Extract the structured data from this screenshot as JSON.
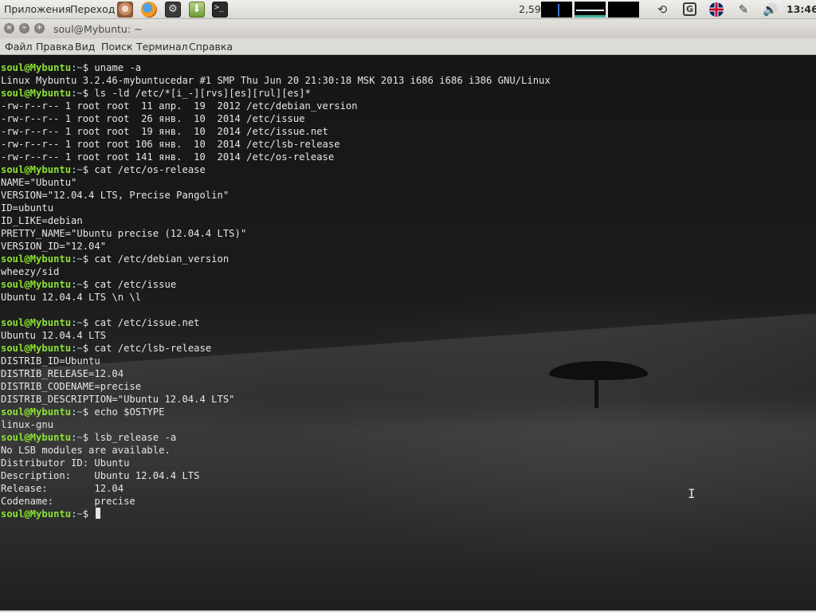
{
  "top_panel": {
    "menus": [
      "Приложения",
      "Переход"
    ],
    "launchers": [
      "home-folder-icon",
      "firefox-icon",
      "system-settings-icon",
      "download-manager-icon",
      "terminal-icon"
    ],
    "terminal_launcher_glyph": ">_",
    "load_average": "2,59",
    "tray": {
      "sync_icon": "⟲",
      "g_icon": "G",
      "tools_icon": "✎",
      "volume_icon": "🔊"
    },
    "clock": "13:46"
  },
  "window": {
    "title": "soul@Mybuntu: ~",
    "close_glyph": "×",
    "min_glyph": "–",
    "max_glyph": "+"
  },
  "menubar": {
    "items": [
      "Файл",
      "Правка",
      "Вид",
      "Поиск",
      "Терминал",
      "Справка"
    ]
  },
  "terminal": {
    "prompt_user": "soul@Mybuntu",
    "prompt_path": "~",
    "prompt_symbol": "$",
    "lines": [
      {
        "type": "prompt",
        "text": " uname -a"
      },
      {
        "type": "output",
        "text": "Linux Mybuntu 3.2.46-mybuntucedar #1 SMP Thu Jun 20 21:30:18 MSK 2013 i686 i686 i386 GNU/Linux"
      },
      {
        "type": "prompt",
        "text": " ls -ld /etc/*[i_-][rvs][es][rul][es]*"
      },
      {
        "type": "output",
        "text": "-rw-r--r-- 1 root root  11 апр.  19  2012 /etc/debian_version"
      },
      {
        "type": "output",
        "text": "-rw-r--r-- 1 root root  26 янв.  10  2014 /etc/issue"
      },
      {
        "type": "output",
        "text": "-rw-r--r-- 1 root root  19 янв.  10  2014 /etc/issue.net"
      },
      {
        "type": "output",
        "text": "-rw-r--r-- 1 root root 106 янв.  10  2014 /etc/lsb-release"
      },
      {
        "type": "output",
        "text": "-rw-r--r-- 1 root root 141 янв.  10  2014 /etc/os-release"
      },
      {
        "type": "prompt",
        "text": " cat /etc/os-release"
      },
      {
        "type": "output",
        "text": "NAME=\"Ubuntu\""
      },
      {
        "type": "output",
        "text": "VERSION=\"12.04.4 LTS, Precise Pangolin\""
      },
      {
        "type": "output",
        "text": "ID=ubuntu"
      },
      {
        "type": "output",
        "text": "ID_LIKE=debian"
      },
      {
        "type": "output",
        "text": "PRETTY_NAME=\"Ubuntu precise (12.04.4 LTS)\""
      },
      {
        "type": "output",
        "text": "VERSION_ID=\"12.04\""
      },
      {
        "type": "prompt",
        "text": " cat /etc/debian_version"
      },
      {
        "type": "output",
        "text": "wheezy/sid"
      },
      {
        "type": "prompt",
        "text": " cat /etc/issue"
      },
      {
        "type": "output",
        "text": "Ubuntu 12.04.4 LTS \\n \\l"
      },
      {
        "type": "output",
        "text": ""
      },
      {
        "type": "prompt",
        "text": " cat /etc/issue.net"
      },
      {
        "type": "output",
        "text": "Ubuntu 12.04.4 LTS"
      },
      {
        "type": "prompt",
        "text": " cat /etc/lsb-release"
      },
      {
        "type": "output",
        "text": "DISTRIB_ID=Ubuntu"
      },
      {
        "type": "output",
        "text": "DISTRIB_RELEASE=12.04"
      },
      {
        "type": "output",
        "text": "DISTRIB_CODENAME=precise"
      },
      {
        "type": "output",
        "text": "DISTRIB_DESCRIPTION=\"Ubuntu 12.04.4 LTS\""
      },
      {
        "type": "prompt",
        "text": " echo $OSTYPE"
      },
      {
        "type": "output",
        "text": "linux-gnu"
      },
      {
        "type": "prompt",
        "text": " lsb_release -a"
      },
      {
        "type": "output",
        "text": "No LSB modules are available."
      },
      {
        "type": "output",
        "text": "Distributor ID: Ubuntu"
      },
      {
        "type": "output",
        "text": "Description:    Ubuntu 12.04.4 LTS"
      },
      {
        "type": "output",
        "text": "Release:        12.04"
      },
      {
        "type": "output",
        "text": "Codename:       precise"
      },
      {
        "type": "current_prompt",
        "text": " "
      }
    ]
  },
  "colors": {
    "prompt_user": "#8ae234",
    "prompt_path": "#729fcf",
    "terminal_text": "#e6e6e6",
    "panel_bg": "#dcdad5"
  }
}
